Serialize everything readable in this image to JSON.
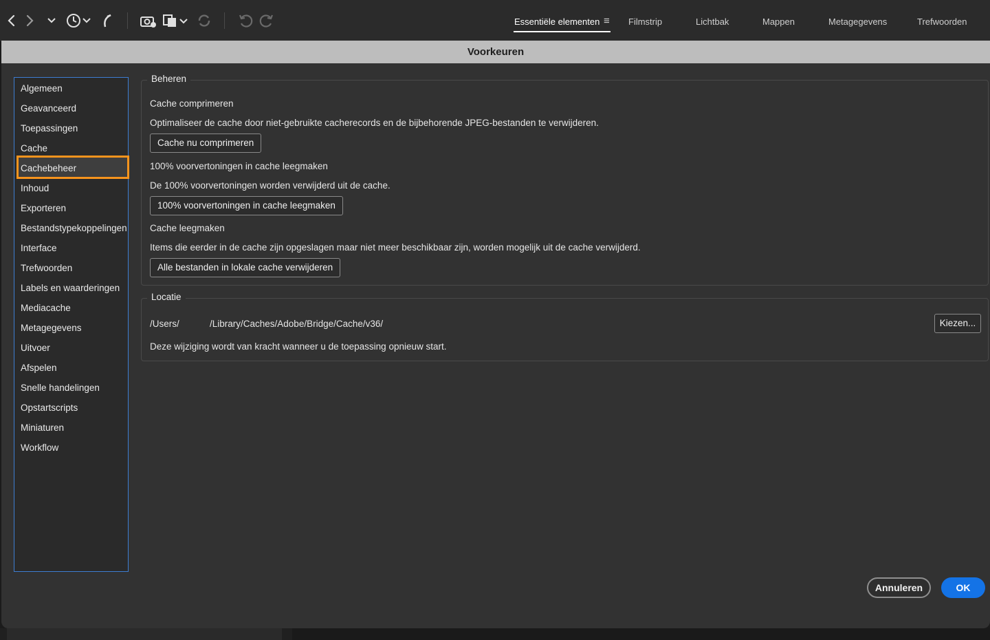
{
  "toolbar": {
    "icons": [
      "back-icon",
      "forward-icon",
      "chevron-down-icon",
      "history-icon",
      "boomerang-icon",
      "camera-download-icon",
      "copy-files-icon",
      "refresh-icon",
      "rotate-left-icon",
      "rotate-right-icon"
    ]
  },
  "workspaces": {
    "tabs": [
      {
        "label": "Essentiële elementen",
        "active": true
      },
      {
        "label": "Filmstrip"
      },
      {
        "label": "Lichtbak"
      },
      {
        "label": "Mappen"
      },
      {
        "label": "Metagegevens"
      },
      {
        "label": "Trefwoorden"
      }
    ],
    "menu_icon": "≡"
  },
  "dialog": {
    "title": "Voorkeuren"
  },
  "sidebar": {
    "items": [
      {
        "label": "Algemeen"
      },
      {
        "label": "Geavanceerd"
      },
      {
        "label": "Toepassingen"
      },
      {
        "label": "Cache"
      },
      {
        "label": "Cachebeheer",
        "selected": true
      },
      {
        "label": "Inhoud"
      },
      {
        "label": "Exporteren"
      },
      {
        "label": "Bestandstypekoppelingen"
      },
      {
        "label": "Interface"
      },
      {
        "label": "Trefwoorden"
      },
      {
        "label": "Labels en waarderingen"
      },
      {
        "label": "Mediacache"
      },
      {
        "label": "Metagegevens"
      },
      {
        "label": "Uitvoer"
      },
      {
        "label": "Afspelen"
      },
      {
        "label": "Snelle handelingen"
      },
      {
        "label": "Opstartscripts"
      },
      {
        "label": "Miniaturen"
      },
      {
        "label": "Workflow"
      }
    ]
  },
  "beheren": {
    "title": "Beheren",
    "compress_heading": "Cache comprimeren",
    "compress_desc": "Optimaliseer de cache door niet-gebruikte cacherecords en de bijbehorende JPEG-bestanden te verwijderen.",
    "compress_button": "Cache nu comprimeren",
    "purge_heading": "100% voorvertoningen in cache leegmaken",
    "purge_desc": "De 100% voorvertoningen worden verwijderd uit de cache.",
    "purge_button": "100% voorvertoningen in cache leegmaken",
    "clear_heading": "Cache leegmaken",
    "clear_desc": "Items die eerder in de cache zijn opgeslagen maar niet meer beschikbaar zijn, worden mogelijk uit de cache verwijderd.",
    "clear_button": "Alle bestanden in lokale cache verwijderen"
  },
  "locatie": {
    "title": "Locatie",
    "path_prefix": "/Users/",
    "path_suffix": "/Library/Caches/Adobe/Bridge/Cache/v36/",
    "choose_button": "Kiezen...",
    "note": "Deze wijziging wordt van kracht wanneer u de toepassing opnieuw start."
  },
  "footer": {
    "cancel": "Annuleren",
    "ok": "OK"
  },
  "colors": {
    "accent": "#1473e6",
    "selection_highlight": "#f7941d",
    "sidebar_border": "#3d7ed3"
  }
}
